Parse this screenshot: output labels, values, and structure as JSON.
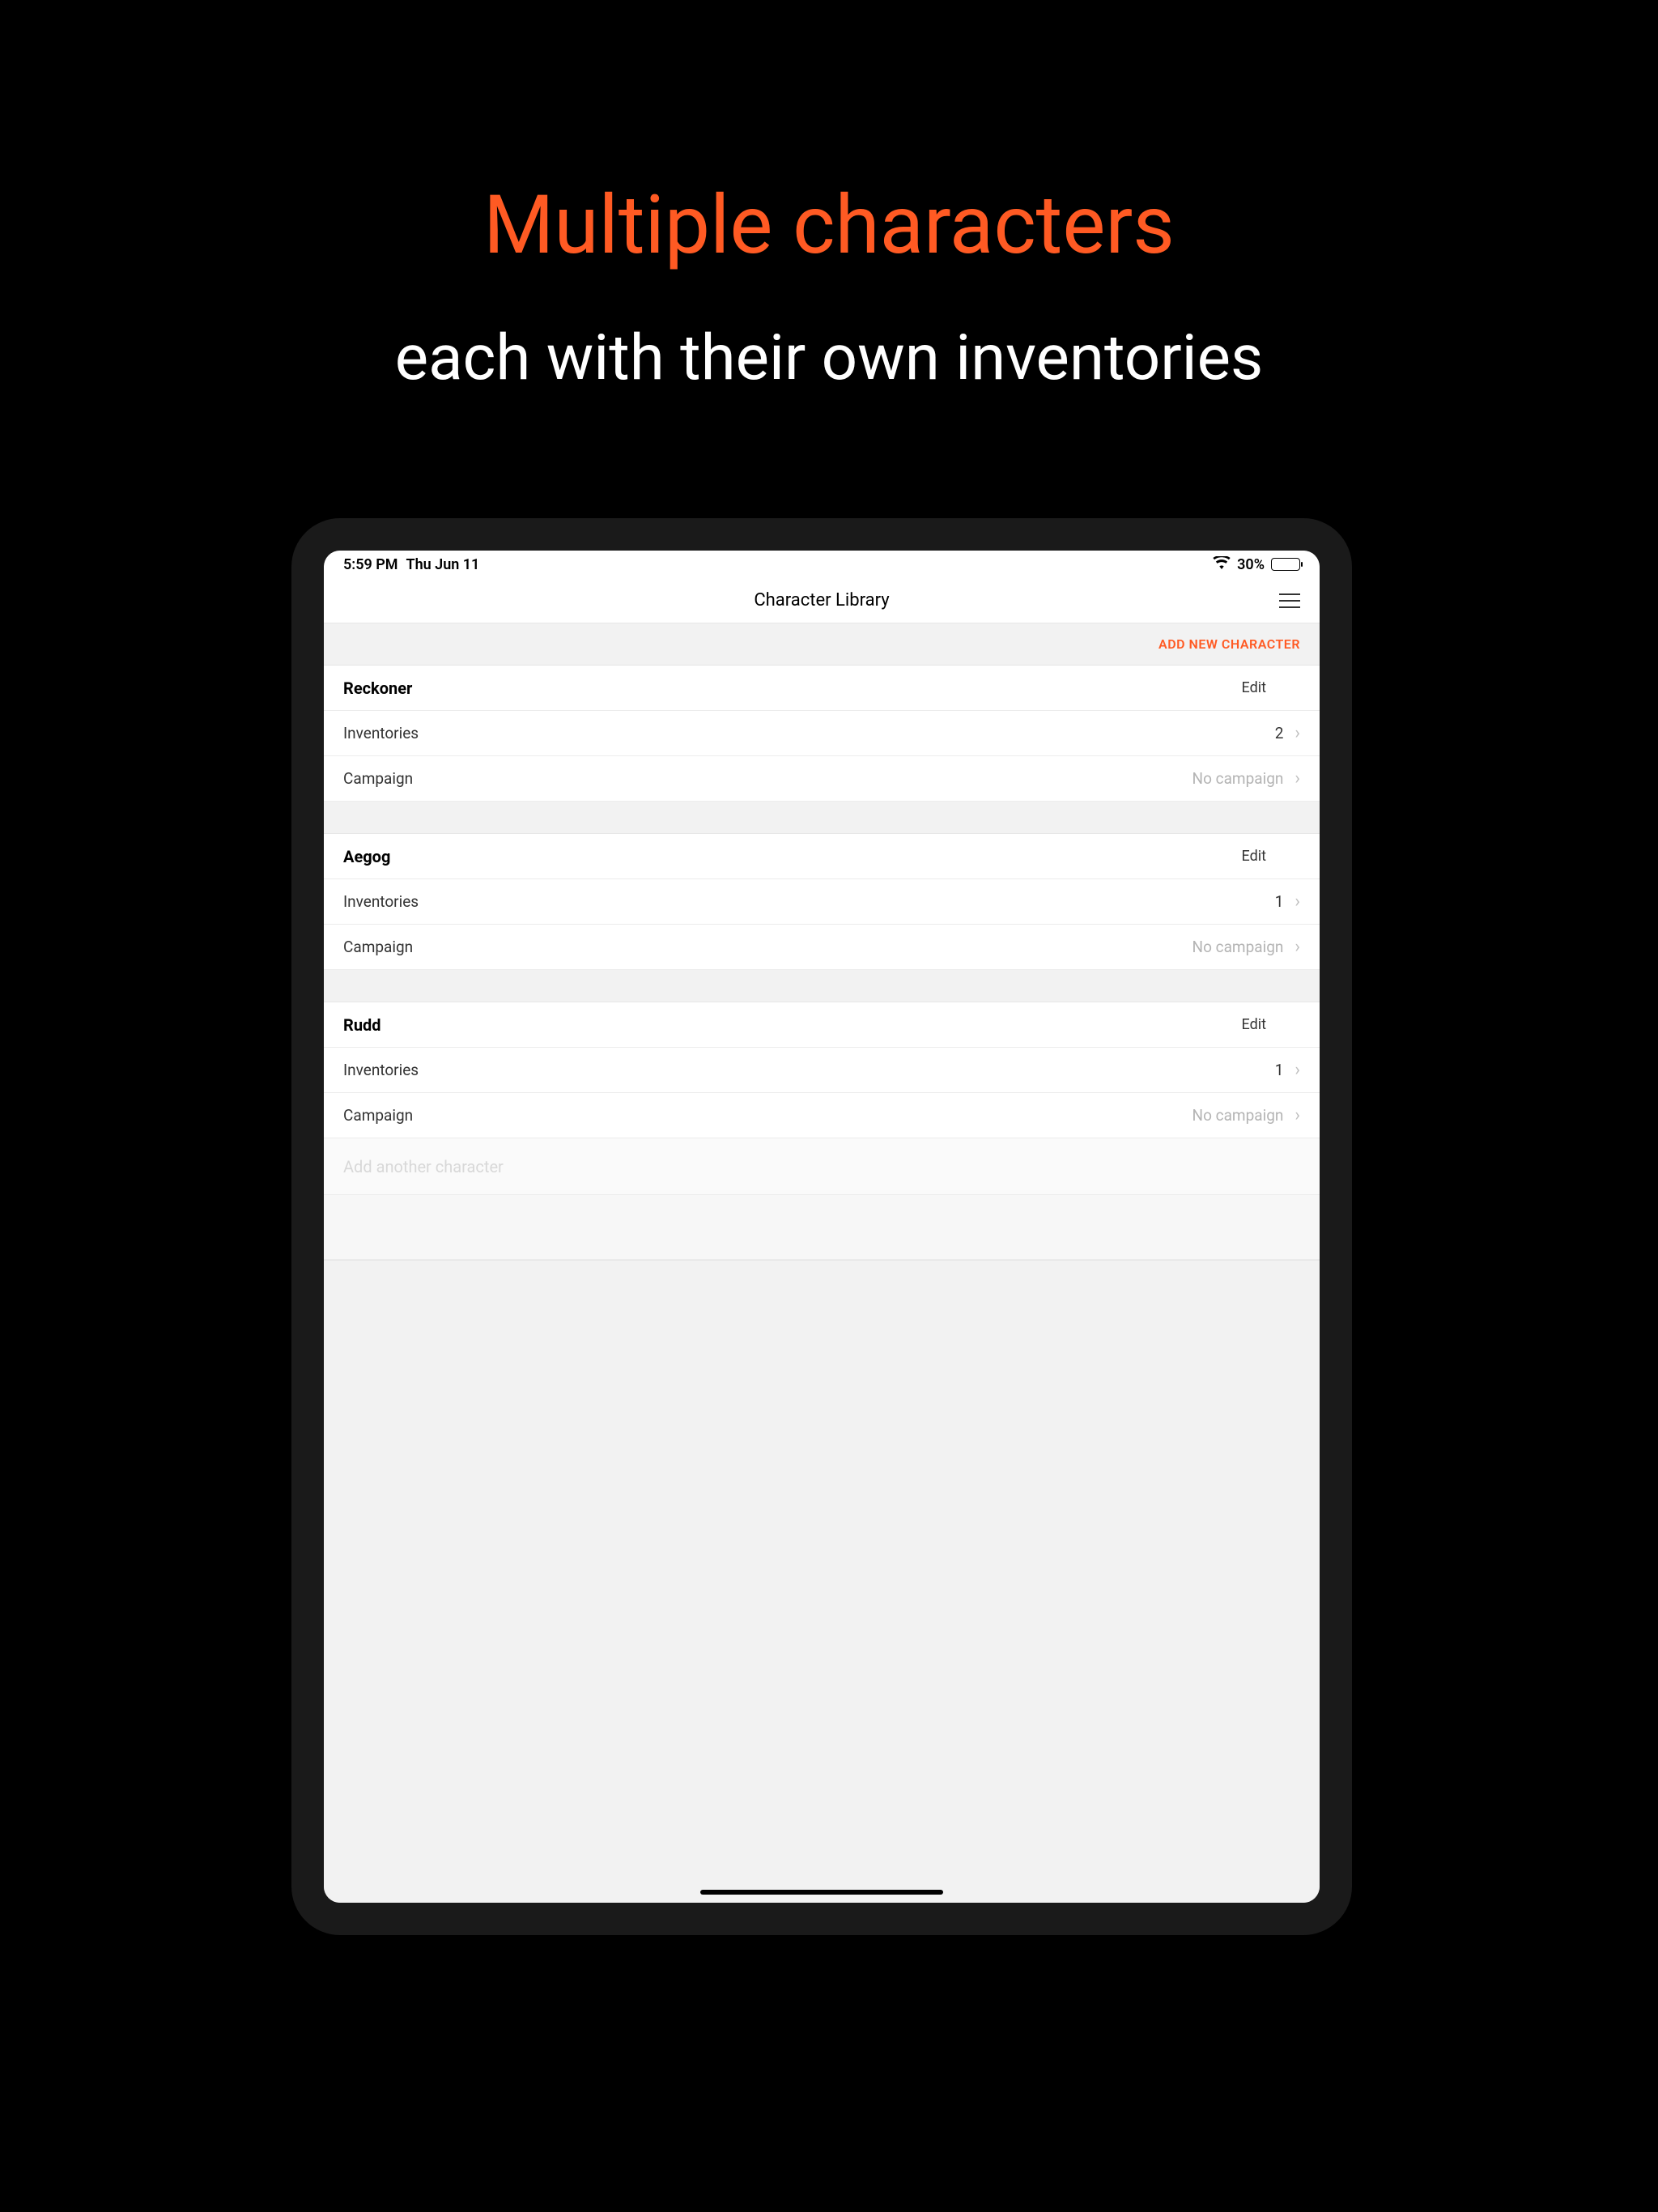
{
  "promo": {
    "title": "Multiple characters",
    "subtitle": "each with their own inventories"
  },
  "status": {
    "time": "5:59 PM",
    "date": "Thu Jun 11",
    "battery_pct": "30%",
    "battery_fill_pct": 30
  },
  "header": {
    "title": "Character Library"
  },
  "actions": {
    "add_new": "ADD NEW CHARACTER",
    "edit": "Edit",
    "add_another": "Add another character"
  },
  "labels": {
    "inventories": "Inventories",
    "campaign": "Campaign",
    "no_campaign": "No campaign"
  },
  "characters": [
    {
      "name": "Reckoner",
      "inventories": "2",
      "campaign": "No campaign"
    },
    {
      "name": "Aegog",
      "inventories": "1",
      "campaign": "No campaign"
    },
    {
      "name": "Rudd",
      "inventories": "1",
      "campaign": "No campaign"
    }
  ]
}
